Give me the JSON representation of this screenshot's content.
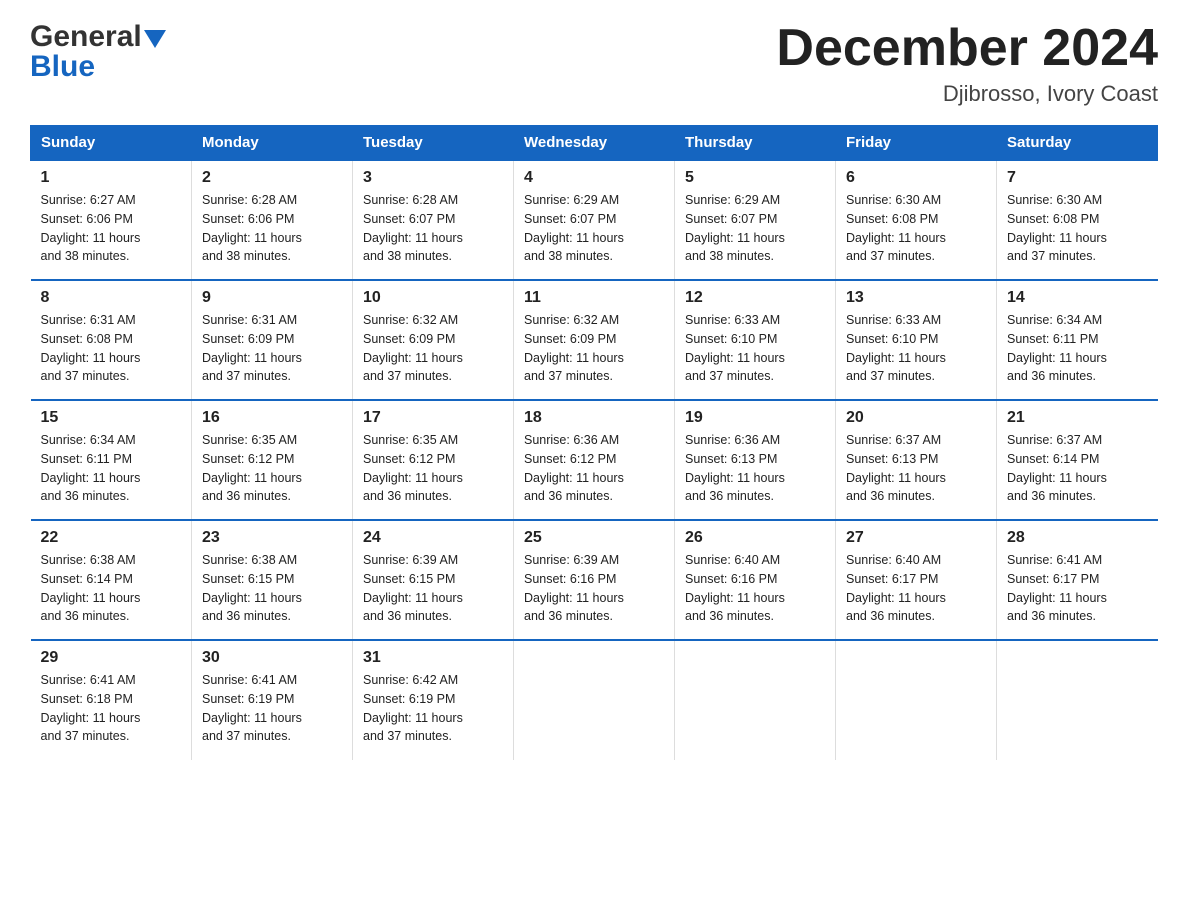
{
  "header": {
    "logo_general": "General",
    "logo_blue": "Blue",
    "title": "December 2024",
    "subtitle": "Djibrosso, Ivory Coast"
  },
  "days_of_week": [
    "Sunday",
    "Monday",
    "Tuesday",
    "Wednesday",
    "Thursday",
    "Friday",
    "Saturday"
  ],
  "weeks": [
    [
      {
        "day": "1",
        "info": "Sunrise: 6:27 AM\nSunset: 6:06 PM\nDaylight: 11 hours\nand 38 minutes."
      },
      {
        "day": "2",
        "info": "Sunrise: 6:28 AM\nSunset: 6:06 PM\nDaylight: 11 hours\nand 38 minutes."
      },
      {
        "day": "3",
        "info": "Sunrise: 6:28 AM\nSunset: 6:07 PM\nDaylight: 11 hours\nand 38 minutes."
      },
      {
        "day": "4",
        "info": "Sunrise: 6:29 AM\nSunset: 6:07 PM\nDaylight: 11 hours\nand 38 minutes."
      },
      {
        "day": "5",
        "info": "Sunrise: 6:29 AM\nSunset: 6:07 PM\nDaylight: 11 hours\nand 38 minutes."
      },
      {
        "day": "6",
        "info": "Sunrise: 6:30 AM\nSunset: 6:08 PM\nDaylight: 11 hours\nand 37 minutes."
      },
      {
        "day": "7",
        "info": "Sunrise: 6:30 AM\nSunset: 6:08 PM\nDaylight: 11 hours\nand 37 minutes."
      }
    ],
    [
      {
        "day": "8",
        "info": "Sunrise: 6:31 AM\nSunset: 6:08 PM\nDaylight: 11 hours\nand 37 minutes."
      },
      {
        "day": "9",
        "info": "Sunrise: 6:31 AM\nSunset: 6:09 PM\nDaylight: 11 hours\nand 37 minutes."
      },
      {
        "day": "10",
        "info": "Sunrise: 6:32 AM\nSunset: 6:09 PM\nDaylight: 11 hours\nand 37 minutes."
      },
      {
        "day": "11",
        "info": "Sunrise: 6:32 AM\nSunset: 6:09 PM\nDaylight: 11 hours\nand 37 minutes."
      },
      {
        "day": "12",
        "info": "Sunrise: 6:33 AM\nSunset: 6:10 PM\nDaylight: 11 hours\nand 37 minutes."
      },
      {
        "day": "13",
        "info": "Sunrise: 6:33 AM\nSunset: 6:10 PM\nDaylight: 11 hours\nand 37 minutes."
      },
      {
        "day": "14",
        "info": "Sunrise: 6:34 AM\nSunset: 6:11 PM\nDaylight: 11 hours\nand 36 minutes."
      }
    ],
    [
      {
        "day": "15",
        "info": "Sunrise: 6:34 AM\nSunset: 6:11 PM\nDaylight: 11 hours\nand 36 minutes."
      },
      {
        "day": "16",
        "info": "Sunrise: 6:35 AM\nSunset: 6:12 PM\nDaylight: 11 hours\nand 36 minutes."
      },
      {
        "day": "17",
        "info": "Sunrise: 6:35 AM\nSunset: 6:12 PM\nDaylight: 11 hours\nand 36 minutes."
      },
      {
        "day": "18",
        "info": "Sunrise: 6:36 AM\nSunset: 6:12 PM\nDaylight: 11 hours\nand 36 minutes."
      },
      {
        "day": "19",
        "info": "Sunrise: 6:36 AM\nSunset: 6:13 PM\nDaylight: 11 hours\nand 36 minutes."
      },
      {
        "day": "20",
        "info": "Sunrise: 6:37 AM\nSunset: 6:13 PM\nDaylight: 11 hours\nand 36 minutes."
      },
      {
        "day": "21",
        "info": "Sunrise: 6:37 AM\nSunset: 6:14 PM\nDaylight: 11 hours\nand 36 minutes."
      }
    ],
    [
      {
        "day": "22",
        "info": "Sunrise: 6:38 AM\nSunset: 6:14 PM\nDaylight: 11 hours\nand 36 minutes."
      },
      {
        "day": "23",
        "info": "Sunrise: 6:38 AM\nSunset: 6:15 PM\nDaylight: 11 hours\nand 36 minutes."
      },
      {
        "day": "24",
        "info": "Sunrise: 6:39 AM\nSunset: 6:15 PM\nDaylight: 11 hours\nand 36 minutes."
      },
      {
        "day": "25",
        "info": "Sunrise: 6:39 AM\nSunset: 6:16 PM\nDaylight: 11 hours\nand 36 minutes."
      },
      {
        "day": "26",
        "info": "Sunrise: 6:40 AM\nSunset: 6:16 PM\nDaylight: 11 hours\nand 36 minutes."
      },
      {
        "day": "27",
        "info": "Sunrise: 6:40 AM\nSunset: 6:17 PM\nDaylight: 11 hours\nand 36 minutes."
      },
      {
        "day": "28",
        "info": "Sunrise: 6:41 AM\nSunset: 6:17 PM\nDaylight: 11 hours\nand 36 minutes."
      }
    ],
    [
      {
        "day": "29",
        "info": "Sunrise: 6:41 AM\nSunset: 6:18 PM\nDaylight: 11 hours\nand 37 minutes."
      },
      {
        "day": "30",
        "info": "Sunrise: 6:41 AM\nSunset: 6:19 PM\nDaylight: 11 hours\nand 37 minutes."
      },
      {
        "day": "31",
        "info": "Sunrise: 6:42 AM\nSunset: 6:19 PM\nDaylight: 11 hours\nand 37 minutes."
      },
      {
        "day": "",
        "info": ""
      },
      {
        "day": "",
        "info": ""
      },
      {
        "day": "",
        "info": ""
      },
      {
        "day": "",
        "info": ""
      }
    ]
  ]
}
